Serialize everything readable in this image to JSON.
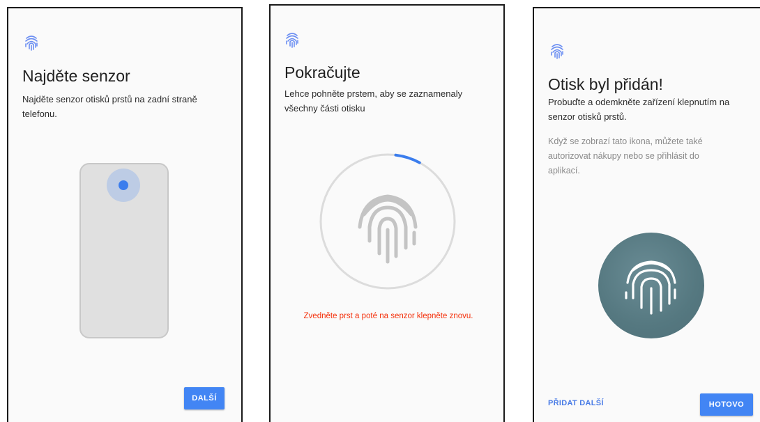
{
  "screens": [
    {
      "title": "Najděte senzor",
      "description": "Najděte senzor otisků prstů na zadní straně telefonu.",
      "primary_button": "DALŠÍ"
    },
    {
      "title": "Pokračujte",
      "description": "Lehce pohněte prstem, aby se zaznamenaly všechny části otisku",
      "error": "Zvedněte prst a poté na senzor klepněte znovu.",
      "progress": 0.06
    },
    {
      "title": "Otisk byl přidán!",
      "description": "Probuďte a odemkněte zařízení klepnutím na senzor otisků prstů.",
      "secondary_text": "Když se zobrazí tato ikona, můžete také autorizovat nákupy nebo se přihlásit do aplikací.",
      "secondary_button": "PŘIDAT DALŠÍ",
      "primary_button": "HOTOVO"
    }
  ],
  "colors": {
    "accent": "#4285f4",
    "error": "#f4300b",
    "fingerprint_circle": "#557880",
    "phone": "#e0e0e0"
  },
  "icons": {
    "header": "fingerprint-icon",
    "sensor": "sensor-dot-icon"
  }
}
